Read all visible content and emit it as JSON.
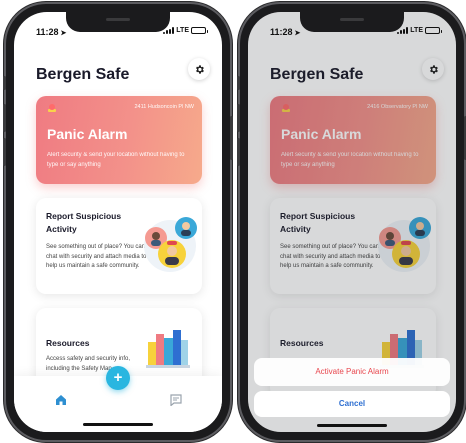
{
  "left": {
    "status": {
      "time": "11:28",
      "network": "LTE"
    },
    "app_title": "Bergen Safe",
    "panic": {
      "address": "2411 Hudsoncoin Pl NW",
      "title": "Panic Alarm",
      "description": "Alert security & send your location without having to type or say anything"
    },
    "report": {
      "title": "Report Suspicious Activity",
      "description": "See something out of place? You can chat with security and attach media to help us maintain a safe community."
    },
    "resources": {
      "title": "Resources",
      "description": "Access safety and security info, including the Safety Map"
    },
    "fab_label": "+"
  },
  "right": {
    "status": {
      "time": "11:28",
      "network": "LTE"
    },
    "app_title": "Bergen Safe",
    "panic": {
      "address": "2416 Observatory Pl NW",
      "title": "Panic Alarm",
      "description": "Alert security & send your location without having to type or say anything"
    },
    "report": {
      "title": "Report Suspicious Activity",
      "description": "See something out of place? You can chat with security and attach media to help us maintain a safe community."
    },
    "resources": {
      "title": "Resources"
    },
    "action_sheet": {
      "activate_label": "Activate Panic Alarm",
      "cancel_label": "Cancel"
    }
  },
  "colors": {
    "panic_gradient_start": "#ef7b82",
    "panic_gradient_end": "#f6aa8b",
    "fab": "#29b6e0",
    "destructive": "#e8484f",
    "cancel": "#2e6fd1"
  }
}
